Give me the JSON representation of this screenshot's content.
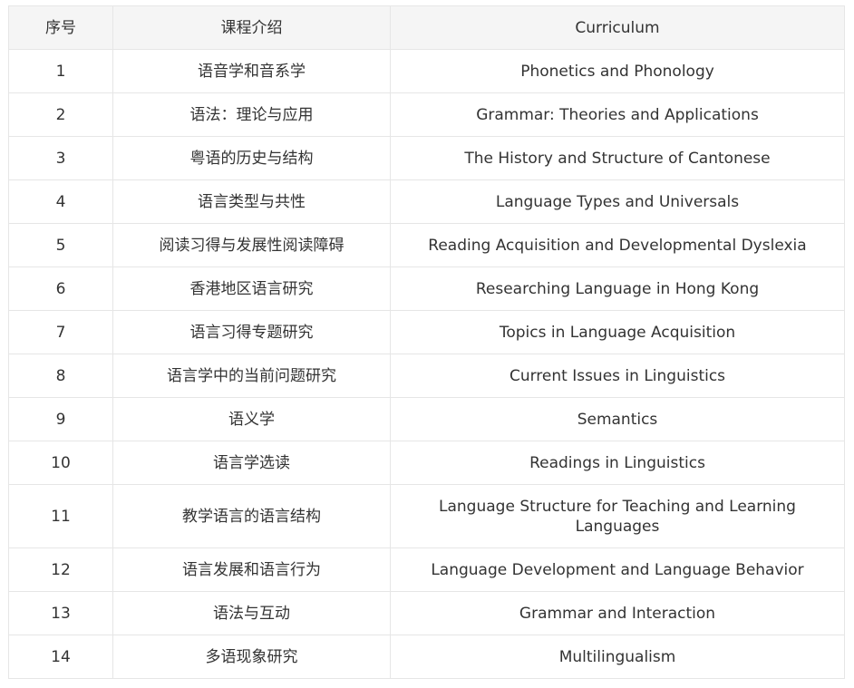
{
  "table": {
    "headers": [
      "序号",
      "课程介绍",
      "Curriculum"
    ],
    "rows": [
      {
        "no": "1",
        "cn": "语音学和音系学",
        "en": "Phonetics and Phonology"
      },
      {
        "no": "2",
        "cn": "语法：理论与应用",
        "en": "Grammar: Theories and Applications"
      },
      {
        "no": "3",
        "cn": "粤语的历史与结构",
        "en": "The History and Structure of Cantonese"
      },
      {
        "no": "4",
        "cn": "语言类型与共性",
        "en": "Language Types and Universals"
      },
      {
        "no": "5",
        "cn": "阅读习得与发展性阅读障碍",
        "en": "Reading Acquisition and Developmental Dyslexia"
      },
      {
        "no": "6",
        "cn": "香港地区语言研究",
        "en": "Researching Language in Hong Kong"
      },
      {
        "no": "7",
        "cn": "语言习得专题研究",
        "en": "Topics in Language Acquisition"
      },
      {
        "no": "8",
        "cn": "语言学中的当前问题研究",
        "en": "Current Issues in Linguistics"
      },
      {
        "no": "9",
        "cn": "语义学",
        "en": "Semantics"
      },
      {
        "no": "10",
        "cn": "语言学选读",
        "en": "Readings in Linguistics"
      },
      {
        "no": "11",
        "cn": "教学语言的语言结构",
        "en": "Language Structure for Teaching and Learning Languages"
      },
      {
        "no": "12",
        "cn": "语言发展和语言行为",
        "en": "Language Development and Language Behavior"
      },
      {
        "no": "13",
        "cn": "语法与互动",
        "en": "Grammar and Interaction"
      },
      {
        "no": "14",
        "cn": "多语现象研究",
        "en": "Multilingualism"
      }
    ]
  }
}
